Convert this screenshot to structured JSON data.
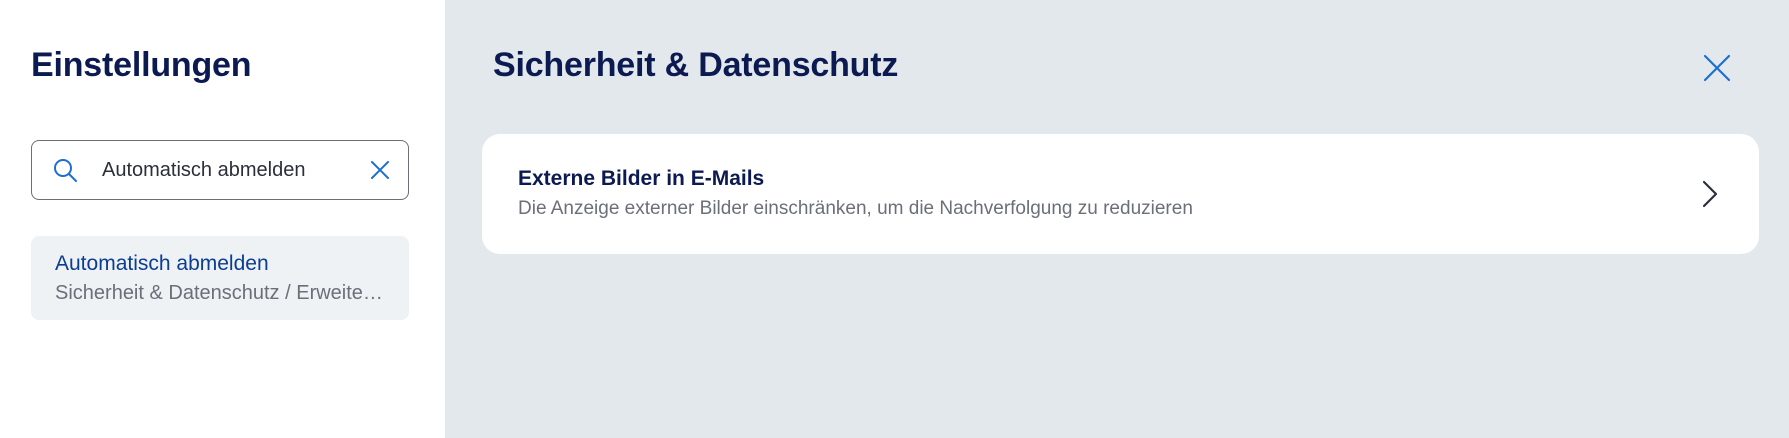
{
  "sidebar": {
    "title": "Einstellungen",
    "search": {
      "value": "Automatisch abmelden",
      "placeholder": ""
    },
    "results": [
      {
        "title": "Automatisch abmelden",
        "path": "Sicherheit & Datenschutz / Erweiterte Einstellungen"
      }
    ]
  },
  "main": {
    "title": "Sicherheit & Datenschutz",
    "cards": [
      {
        "title": "Externe Bilder in E-Mails",
        "description": "Die Anzeige externer Bilder einschränken, um die Nachverfolgung zu reduzieren"
      }
    ]
  },
  "icons": {
    "search": "search-icon",
    "clear": "close-icon",
    "close": "close-icon",
    "chevron": "chevron-right-icon"
  },
  "colors": {
    "heading": "#0c1a52",
    "accent": "#1f6fd1",
    "link": "#0b3d91",
    "muted": "#6b6f78",
    "main_bg": "#e3e8ec",
    "result_bg": "#eef2f5"
  }
}
